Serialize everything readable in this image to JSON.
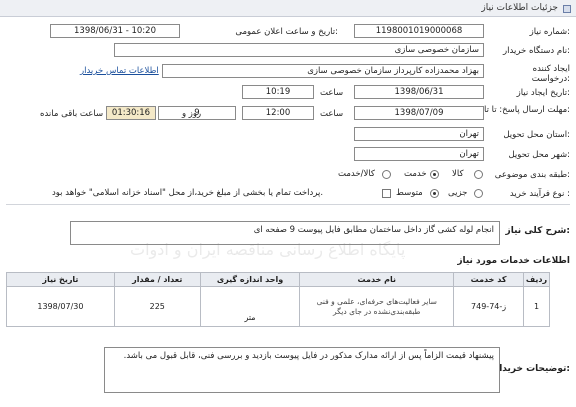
{
  "header": {
    "title": "جزئیات اطلاعات نیاز"
  },
  "form": {
    "need_number_label": "شماره نیاز:",
    "need_number": "1198001019000068",
    "announce_label": "تاریخ و ساعت اعلان عمومی:",
    "announce_value": "1398/06/31 - 10:20",
    "buyer_org_label": "نام دستگاه خریدار:",
    "buyer_org": "سازمان خصوصی سازی",
    "creator_label": "ایجاد کننده درخواست:",
    "creator": "بهزاد محمدزاده کارپرداز سازمان خصوصی سازی",
    "contact_link": "اطلاعات تماس خریدار",
    "created_date_label": "تاریخ ایجاد نیاز:",
    "created_date": "1398/06/31",
    "created_time_label": "ساعت",
    "created_time": "10:19",
    "deadline_label": "مهلت ارسال پاسخ: تا تاریخ:",
    "deadline_date": "1398/07/09",
    "deadline_time_label": "ساعت",
    "deadline_time": "12:00",
    "days": "9",
    "days_label": "روز و",
    "remaining": "01:30:16",
    "remaining_label": "ساعت باقی مانده",
    "province_label": "استان محل تحویل:",
    "province": "تهران",
    "city_label": "شهر محل تحویل:",
    "city": "تهران",
    "category_label": "طبقه بندی موضوعی:",
    "category_options": [
      "کالا",
      "خدمت",
      "کالا/خدمت"
    ],
    "category_selected": "خدمت",
    "purchase_type_label": "نوع فرآیند خرید :",
    "purchase_options": [
      "جزیی",
      "متوسط"
    ],
    "purchase_selected": "متوسط",
    "treasury_note": "پرداخت تمام یا بخشی از مبلغ خرید،از محل \"اسناد خزانه اسلامی\" خواهد بود."
  },
  "summary": {
    "label": "شرح کلی نیاز:",
    "text": "انجام لوله کشی گاز داخل ساختمان مطابق فایل پیوست 9 صفحه ای"
  },
  "services": {
    "title": "اطلاعات خدمات مورد نیاز",
    "columns": [
      "ردیف",
      "کد خدمت",
      "نام خدمت",
      "واحد اندازه گیری",
      "تعداد / مقدار",
      "تاریخ نیاز"
    ],
    "rows": [
      {
        "row": "1",
        "code": "ز-74-749",
        "name": "سایر فعالیت‌های حرفه‌ای، علمی و فنی طبقه‌بندی‌نشده در جای دیگر",
        "unit": "متر",
        "qty": "225",
        "date": "1398/07/30"
      }
    ]
  },
  "buyer_notes": {
    "label": "توضیحات خریدار:",
    "text": "پیشنهاد قیمت الزاماً پس از ارائه مدارک مذکور در فایل پیوست بازدید و بررسی فنی، قابل قبول می باشد."
  },
  "watermark": "پایگاه اطلاع رسانی مناقصه ایران و ادوات"
}
